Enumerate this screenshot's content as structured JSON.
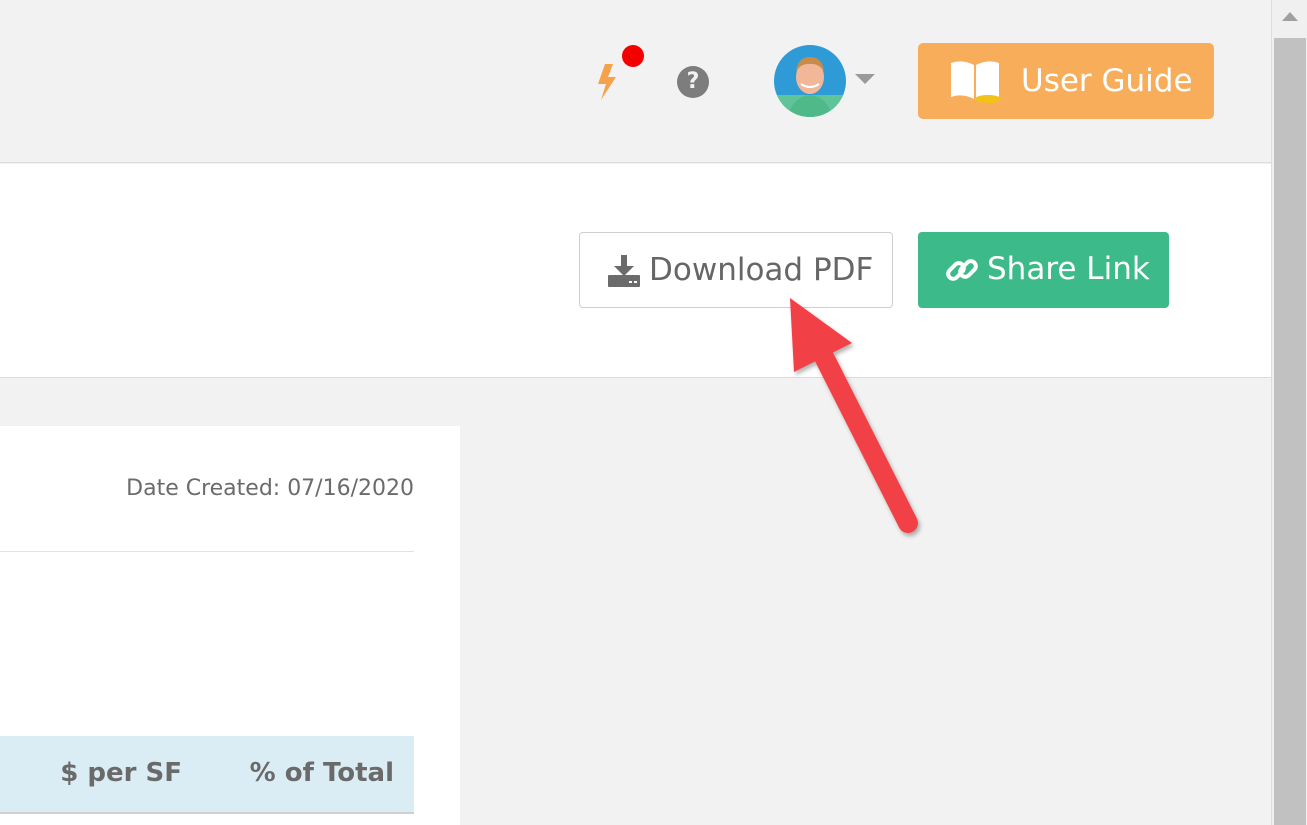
{
  "header": {
    "icons": {
      "activity": "lightning-bolt-icon",
      "help": "question-circle-icon",
      "help_glyph": "?",
      "caret": "chevron-down-icon",
      "guide": "book-open-icon"
    },
    "user_guide_label": "User Guide"
  },
  "actions": {
    "download_label": "Download PDF",
    "share_label": "Share Link",
    "download_icon": "download-icon",
    "share_icon": "link-icon"
  },
  "report": {
    "date_created": "Date Created: 07/16/2020",
    "columns": [
      "$ per SF",
      "% of Total"
    ]
  },
  "colors": {
    "accent_orange": "#f8ad5a",
    "share_green": "#3dba8a",
    "notification_red": "#f40000",
    "table_header_bg": "#dbedf4",
    "arrow_red": "#f24146"
  }
}
